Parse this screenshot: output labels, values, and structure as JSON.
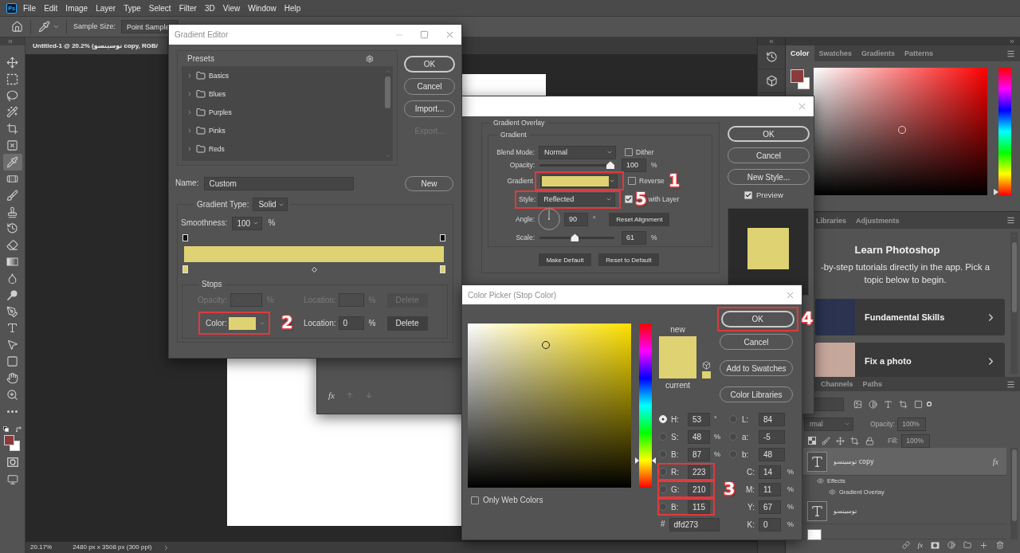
{
  "menu_bar": {
    "logo": "Ps",
    "items": [
      "File",
      "Edit",
      "Image",
      "Layer",
      "Type",
      "Select",
      "Filter",
      "3D",
      "View",
      "Window",
      "Help"
    ]
  },
  "options_bar": {
    "sample_size_label": "Sample Size:",
    "sample_size": "Point Sample"
  },
  "toolbar": {
    "tools": [
      {
        "selected": false
      },
      {
        "selected": false
      },
      {
        "selected": false
      },
      {
        "selected": false
      },
      {
        "selected": false
      },
      {
        "selected": false
      },
      {
        "selected": true
      },
      {
        "selected": false
      },
      {
        "selected": false
      },
      {
        "selected": false
      },
      {
        "selected": false
      },
      {
        "selected": false
      },
      {
        "selected": false
      },
      {
        "selected": false
      },
      {
        "selected": false
      },
      {
        "selected": false
      },
      {
        "selected": false
      },
      {
        "selected": false
      },
      {
        "selected": false
      },
      {
        "selected": false
      },
      {
        "selected": false
      },
      {
        "selected": false
      }
    ]
  },
  "document_tab": {
    "title": "Untitled-1 @ 20.2% (توسینسو copy, RGB/"
  },
  "gradient_editor": {
    "title": "Gradient Editor",
    "presets_label": "Presets",
    "presets": [
      {
        "name": "Basics",
        "expanded": false
      },
      {
        "name": "Blues",
        "expanded": false
      },
      {
        "name": "Purples",
        "expanded": false
      },
      {
        "name": "Pinks",
        "expanded": false
      },
      {
        "name": "Reds",
        "expanded": false
      }
    ],
    "buttons": [
      {
        "label": "OK",
        "default": true,
        "disabled": false
      },
      {
        "label": "Cancel",
        "default": false,
        "disabled": false
      },
      {
        "label": "Import...",
        "default": false,
        "disabled": false
      },
      {
        "label": "Export...",
        "default": false,
        "disabled": true
      }
    ],
    "name_label": "Name:",
    "name": "Custom",
    "new_button": "New",
    "gradient_type_label": "Gradient Type:",
    "gradient_type": "Solid",
    "smoothness_label": "Smoothness:",
    "smoothness": "100",
    "smoothness_unit": "%",
    "stops_label": "Stops",
    "opacity_stop": {
      "disabled": true,
      "label": "Opacity:",
      "unit": "%",
      "location_label": "Location:",
      "location_unit": "%",
      "delete": "Delete"
    },
    "color_stop": {
      "disabled": false,
      "label": "Color:",
      "callout": "2",
      "location_label": "Location:",
      "location": "0",
      "location_unit": "%",
      "delete": "Delete"
    }
  },
  "layer_style": {
    "section_title": "Gradient Overlay",
    "group_title": "Gradient",
    "blend_mode_label": "Blend Mode:",
    "blend_mode": "Normal",
    "dither": {
      "label": "Dither",
      "checked": false
    },
    "opacity_label": "Opacity:",
    "opacity_slider": {
      "level": 1
    },
    "opacity": "100",
    "opacity_unit": "%",
    "gradient_label": "Gradient",
    "gradient_callout": "1",
    "reverse": {
      "label": "Reverse",
      "checked": false
    },
    "style_label": "Style:",
    "style": "Reflected",
    "style_callout": "5",
    "align": {
      "label": "with Layer",
      "checked": true
    },
    "angle_label": "Angle:",
    "angle": "90",
    "angle_unit": "°",
    "reset_alignment": "Reset Alignment",
    "scale_label": "Scale:",
    "scale_slider": {
      "level": 0.47
    },
    "scale": "61",
    "scale_unit": "%",
    "make_default": "Make Default",
    "reset_to_default": "Reset to Default",
    "buttons": [
      {
        "label": "OK",
        "default": true
      },
      {
        "label": "Cancel",
        "default": false
      },
      {
        "label": "New Style...",
        "default": false
      }
    ],
    "preview": {
      "label": "Preview",
      "checked": true
    },
    "footer_fx": "fx"
  },
  "color_picker": {
    "title": "Color Picker (Stop Color)",
    "new_label": "new",
    "current_label": "current",
    "buttons": [
      {
        "label": "OK",
        "default": true,
        "callout": "4"
      },
      {
        "label": "Cancel",
        "default": false
      },
      {
        "label": "Add to Swatches",
        "default": false
      },
      {
        "label": "Color Libraries",
        "default": false
      }
    ],
    "hue_slider": {
      "level": 0.15
    },
    "hsb_rgb": [
      {
        "label": "H:",
        "value": "53",
        "unit": "°",
        "selected": true,
        "highlighted": false
      },
      {
        "label": "S:",
        "value": "48",
        "unit": "%",
        "selected": false,
        "highlighted": false
      },
      {
        "label": "B:",
        "value": "87",
        "unit": "%",
        "selected": false,
        "highlighted": false
      },
      {
        "label": "R:",
        "value": "223",
        "selected": false,
        "highlighted": true
      },
      {
        "label": "G:",
        "value": "210",
        "selected": false,
        "highlighted": true
      },
      {
        "label": "B:",
        "value": "115",
        "selected": false,
        "highlighted": true
      }
    ],
    "rgb_callout": "3",
    "lab": [
      {
        "label": "L:",
        "value": "84",
        "selected": false
      },
      {
        "label": "a:",
        "value": "-5",
        "selected": false
      },
      {
        "label": "b:",
        "value": "48",
        "selected": false
      }
    ],
    "cmyk": [
      {
        "label": "C:",
        "value": "14",
        "unit": "%"
      },
      {
        "label": "M:",
        "value": "11",
        "unit": "%"
      },
      {
        "label": "Y:",
        "value": "67",
        "unit": "%"
      },
      {
        "label": "K:",
        "value": "0",
        "unit": "%"
      }
    ],
    "hex_label": "#",
    "hex": "dfd273",
    "web_colors": {
      "label": "Only Web Colors",
      "checked": false
    }
  },
  "color_panel": {
    "tabs": [
      {
        "label": "Color",
        "selected": true
      },
      {
        "label": "Swatches",
        "selected": false
      },
      {
        "label": "Gradients",
        "selected": false
      },
      {
        "label": "Patterns",
        "selected": false
      }
    ],
    "hue_slider": {
      "level": 0
    }
  },
  "learn_panel": {
    "tabs": [
      {
        "label": "Libraries",
        "selected": false
      },
      {
        "label": "Adjustments",
        "selected": false
      }
    ],
    "title": "Learn Photoshop",
    "text": "-by-step tutorials directly in the app. Pick a topic below to begin.",
    "cards": [
      {
        "label": "Fundamental Skills"
      },
      {
        "label": "Fix a photo"
      }
    ]
  },
  "layers_panel": {
    "tabs": [
      {
        "label": "Channels",
        "selected": false
      },
      {
        "label": "Paths",
        "selected": false
      }
    ],
    "options_disabled": true,
    "blend_mode": "rmal",
    "opacity_label": "Opacity:",
    "opacity": "100%",
    "fill_label": "Fill:",
    "fill": "100%",
    "layers": [
      {
        "kind": "text",
        "name": "توسینسو copy",
        "selected": true,
        "fx": "fx",
        "effects_label": "Effects",
        "effects": [
          "Gradient Overlay"
        ]
      },
      {
        "kind": "text",
        "name": "توسینسو",
        "selected": false
      },
      {
        "kind": "pixel",
        "selected": false
      }
    ],
    "footer_fx": "fx"
  },
  "status_bar": {
    "zoom": "20.17%",
    "document_size": "2480 px x 3508 px (300 ppi)"
  }
}
